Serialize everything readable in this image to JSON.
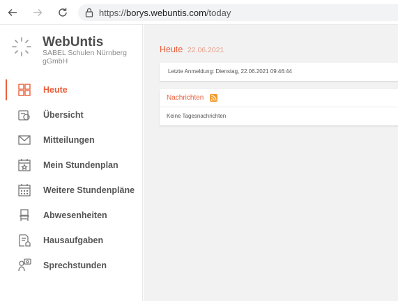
{
  "browser": {
    "url_prefix": "https://",
    "url_host": "borys.webuntis.com",
    "url_path": "/today"
  },
  "sidebar": {
    "brand": "WebUntis",
    "school": "SABEL Schulen Nürnberg gGmbH",
    "items": [
      {
        "label": "Heute",
        "icon": "dashboard-icon",
        "active": true
      },
      {
        "label": "Übersicht",
        "icon": "overview-icon",
        "active": false
      },
      {
        "label": "Mitteilungen",
        "icon": "envelope-icon",
        "active": false
      },
      {
        "label": "Mein Stundenplan",
        "icon": "calendar-star-icon",
        "active": false
      },
      {
        "label": "Weitere Stundenpläne",
        "icon": "calendar-grid-icon",
        "active": false
      },
      {
        "label": "Abwesenheiten",
        "icon": "chair-icon",
        "active": false
      },
      {
        "label": "Hausaufgaben",
        "icon": "homework-icon",
        "active": false
      },
      {
        "label": "Sprechstunden",
        "icon": "consultation-icon",
        "active": false
      }
    ]
  },
  "main": {
    "title": "Heute",
    "date": "22.06.2021",
    "last_login": "Letzte Anmeldung: Dienstag, 22.06.2021 09:46:44",
    "news_title": "Nachrichten",
    "news_empty": "Keine Tagesnachrichten"
  },
  "colors": {
    "accent": "#e8603c",
    "rss": "#f39a2c"
  }
}
